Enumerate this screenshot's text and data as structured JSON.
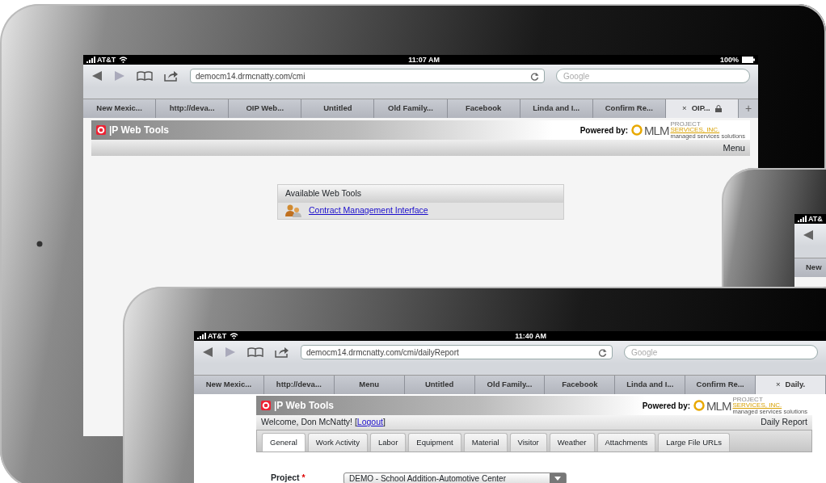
{
  "devices": [
    {
      "status_bar": {
        "carrier": "AT&T",
        "time": "11:07 AM",
        "battery": "100%"
      },
      "address": "democm14.drmcnatty.com/cmi",
      "search": {
        "placeholder": "Google"
      },
      "tabs": [
        {
          "label": "New Mexic...",
          "selected": false
        },
        {
          "label": "http://deva...",
          "selected": false
        },
        {
          "label": "OIP Web...",
          "selected": false
        },
        {
          "label": "Untitled",
          "selected": false
        },
        {
          "label": "Old Family...",
          "selected": false
        },
        {
          "label": "Facebook",
          "selected": false
        },
        {
          "label": "Linda and I...",
          "selected": false
        },
        {
          "label": "Confirm Re...",
          "selected": false
        },
        {
          "label": "OIP...",
          "selected": true,
          "close": "×"
        }
      ],
      "new_tab": "+",
      "page": {
        "brand": "|P Web Tools",
        "powered_by": "Powered by:",
        "partner_logo": {
          "name": "MLM",
          "line_1": "PROJECT",
          "line_2": "SERVICES, INC.",
          "tagline": "managed services solutions"
        },
        "menu": "Menu",
        "tool_panel": {
          "title": "Available Web Tools",
          "links": [
            "Contract Management Interface"
          ]
        }
      }
    },
    {
      "status_bar": {
        "carrier": "AT&"
      },
      "tabs": [
        {
          "label": "New",
          "selected": false
        }
      ]
    },
    {
      "status_bar": {
        "carrier": "AT&T",
        "time": "11:40 AM"
      },
      "address": "democm14.drmcnatty.com/cmi/dailyReport",
      "search": {
        "placeholder": "Google"
      },
      "tabs": [
        {
          "label": "New Mexic...",
          "selected": false
        },
        {
          "label": "http://deva...",
          "selected": false
        },
        {
          "label": "Menu",
          "selected": false
        },
        {
          "label": "Untitled",
          "selected": false
        },
        {
          "label": "Old Family...",
          "selected": false
        },
        {
          "label": "Facebook",
          "selected": false
        },
        {
          "label": "Linda and I...",
          "selected": false
        },
        {
          "label": "Confirm Re...",
          "selected": false
        },
        {
          "label": "Daily.",
          "selected": true,
          "close": "×"
        }
      ],
      "page": {
        "brand": "|P Web Tools",
        "powered_by": "Powered by:",
        "partner_logo": {
          "name": "MLM",
          "line_1": "PROJECT",
          "line_2": "SERVICES, INC.",
          "tagline": "managed services solutions"
        },
        "welcome": {
          "before": "Welcome, Don McNatty! [",
          "link": "Logout",
          "after": "]"
        },
        "report_title": "Daily Report",
        "form_tabs": [
          {
            "label": "General",
            "selected": true
          },
          {
            "label": "Work Activity",
            "selected": false
          },
          {
            "label": "Labor",
            "selected": false
          },
          {
            "label": "Equipment",
            "selected": false
          },
          {
            "label": "Material",
            "selected": false
          },
          {
            "label": "Visitor",
            "selected": false
          },
          {
            "label": "Weather",
            "selected": false
          },
          {
            "label": "Attachments",
            "selected": false
          },
          {
            "label": "Large File URLs",
            "selected": false
          }
        ],
        "fields": [
          {
            "label": "Project",
            "required_mark": "*",
            "value": "DEMO - School Addition-Automotive Center"
          }
        ]
      }
    }
  ]
}
